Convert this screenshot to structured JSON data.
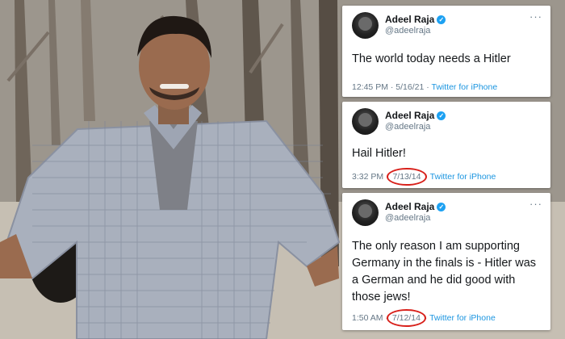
{
  "tweets": [
    {
      "name": "Adeel Raja",
      "handle": "@adeelraja",
      "text": "The world today needs a Hitler",
      "time": "12:45 PM",
      "date": "5/16/21",
      "source": "Twitter for iPhone",
      "date_circled": false
    },
    {
      "name": "Adeel Raja",
      "handle": "@adeelraja",
      "text": "Hail Hitler!",
      "time": "3:32 PM",
      "date": "7/13/14",
      "source": "Twitter for iPhone",
      "date_circled": true
    },
    {
      "name": "Adeel Raja",
      "handle": "@adeelraja",
      "text": "The only reason I am supporting Germany in the finals is - Hitler was a German and he did good with those jews!",
      "time": "1:50 AM",
      "date": "7/12/14",
      "source": "Twitter for iPhone",
      "date_circled": true
    }
  ],
  "colors": {
    "verified": "#1da1f2",
    "link": "#1b95e0",
    "circle": "#d8201a"
  }
}
